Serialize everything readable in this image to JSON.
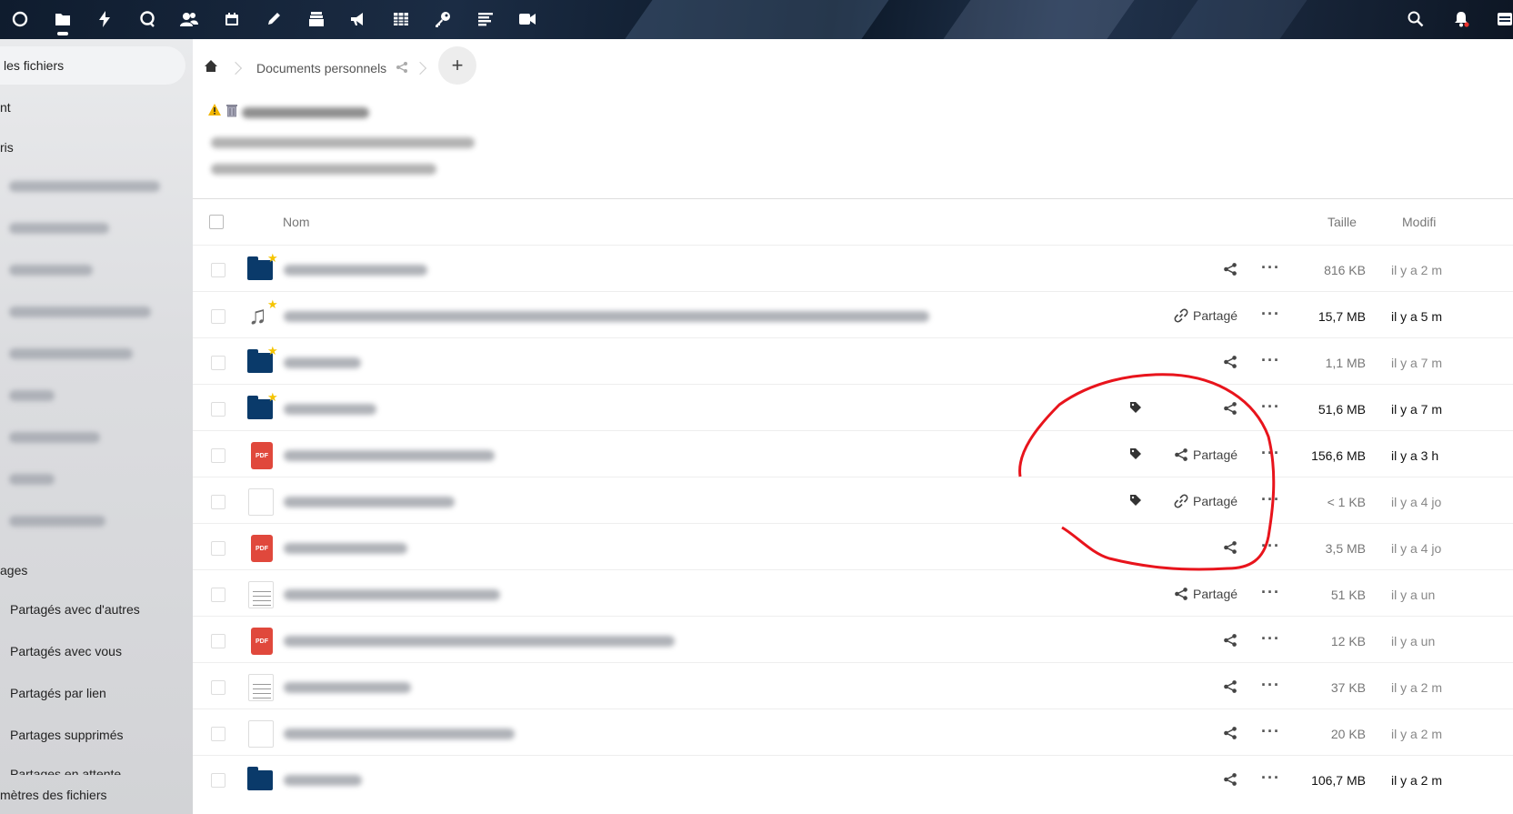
{
  "topbar": {
    "apps": [
      "dashboard-icon",
      "files-icon",
      "activity-icon",
      "talk-icon",
      "contacts-icon",
      "calendar-icon",
      "notes-icon",
      "deck-icon",
      "announcements-icon",
      "tables-icon",
      "passwords-icon",
      "tasks-icon",
      "video-icon"
    ],
    "right_icons": [
      "search-icon",
      "notifications-icon",
      "account-icon"
    ]
  },
  "sidebar": {
    "all_files": "les fichiers",
    "recent_partial": "nt",
    "favorites_partial": "ris",
    "shares_partial": "ages",
    "shared_with_others": "Partagés avec d'autres",
    "shared_with_you": "Partagés avec vous",
    "shared_by_link": "Partagés par lien",
    "deleted_shares": "Partages supprimés",
    "pending_shares": "Partages en attente",
    "settings": "mètres des fichiers"
  },
  "breadcrumb": {
    "folder": "Documents personnels",
    "new_button": "+"
  },
  "table": {
    "col_name": "Nom",
    "col_size": "Taille",
    "col_modified": "Modifi",
    "rows": [
      {
        "type": "folder",
        "star": true,
        "share": "icon",
        "size": "816 KB",
        "bold": false,
        "modified": "il y a 2 m",
        "blur": 158
      },
      {
        "type": "music",
        "star": true,
        "share": "link",
        "share_label": "Partagé",
        "size": "15,7 MB",
        "bold": true,
        "modified": "il y a 5 m",
        "blur": 710
      },
      {
        "type": "folder",
        "star": true,
        "share": "icon",
        "size": "1,1 MB",
        "bold": false,
        "modified": "il y a 7 m",
        "blur": 85
      },
      {
        "type": "folder",
        "star": true,
        "tag": true,
        "share": "icon",
        "size": "51,6 MB",
        "bold": true,
        "modified": "il y a 7 m",
        "blur": 102
      },
      {
        "type": "pdf",
        "tag": true,
        "share": "shared",
        "share_label": "Partagé",
        "size": "156,6 MB",
        "bold": true,
        "modified": "il y a 3 h",
        "blur": 232
      },
      {
        "type": "doc",
        "tag": true,
        "share": "link",
        "share_label": "Partagé",
        "size": "< 1 KB",
        "bold": false,
        "modified": "il y a 4 jo",
        "blur": 188
      },
      {
        "type": "pdf",
        "share": "icon",
        "size": "3,5 MB",
        "bold": false,
        "modified": "il y a 4 jo",
        "blur": 136
      },
      {
        "type": "doclines",
        "share": "shared",
        "share_label": "Partagé",
        "size": "51 KB",
        "bold": false,
        "modified": "il y a un",
        "blur": 238
      },
      {
        "type": "pdf",
        "share": "icon",
        "size": "12 KB",
        "bold": false,
        "modified": "il y a un",
        "blur": 430
      },
      {
        "type": "doclines",
        "share": "icon",
        "size": "37 KB",
        "bold": false,
        "modified": "il y a 2 m",
        "blur": 140
      },
      {
        "type": "doc",
        "share": "icon",
        "size": "20 KB",
        "bold": false,
        "modified": "il y a 2 m",
        "blur": 254
      },
      {
        "type": "folder",
        "share": "icon",
        "size": "106,7 MB",
        "bold": true,
        "modified": "il y a 2 m",
        "blur": 86
      }
    ]
  },
  "colors": {
    "folder": "#0a3a6a",
    "pdf": "#e0483c",
    "annotation": "#e8141c",
    "star": "#f5c400"
  }
}
